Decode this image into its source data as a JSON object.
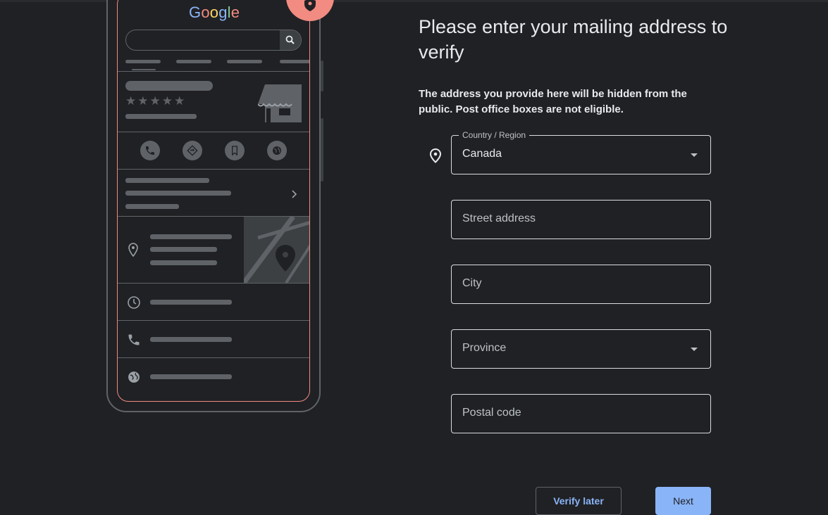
{
  "illustration": {
    "logo": {
      "text": "Google",
      "colors": [
        "#8ab4f8",
        "#f28b82",
        "#fdd663",
        "#8ab4f8",
        "#81c995",
        "#f28b82"
      ]
    },
    "rating": "★★★★★"
  },
  "form": {
    "title": "Please enter your mailing address to verify",
    "subtitle": "The address you provide here will be hidden from the public. Post office boxes are not eligible.",
    "country": {
      "label": "Country / Region",
      "value": "Canada"
    },
    "street": {
      "placeholder": "Street address"
    },
    "city": {
      "placeholder": "City"
    },
    "province": {
      "placeholder": "Province"
    },
    "postal": {
      "placeholder": "Postal code"
    }
  },
  "actions": {
    "verify_later": "Verify later",
    "next": "Next"
  },
  "colors": {
    "background": "#202124",
    "accent": "#8ab4f8",
    "illustration_highlight": "#f28b82",
    "border": "#dadce0"
  }
}
